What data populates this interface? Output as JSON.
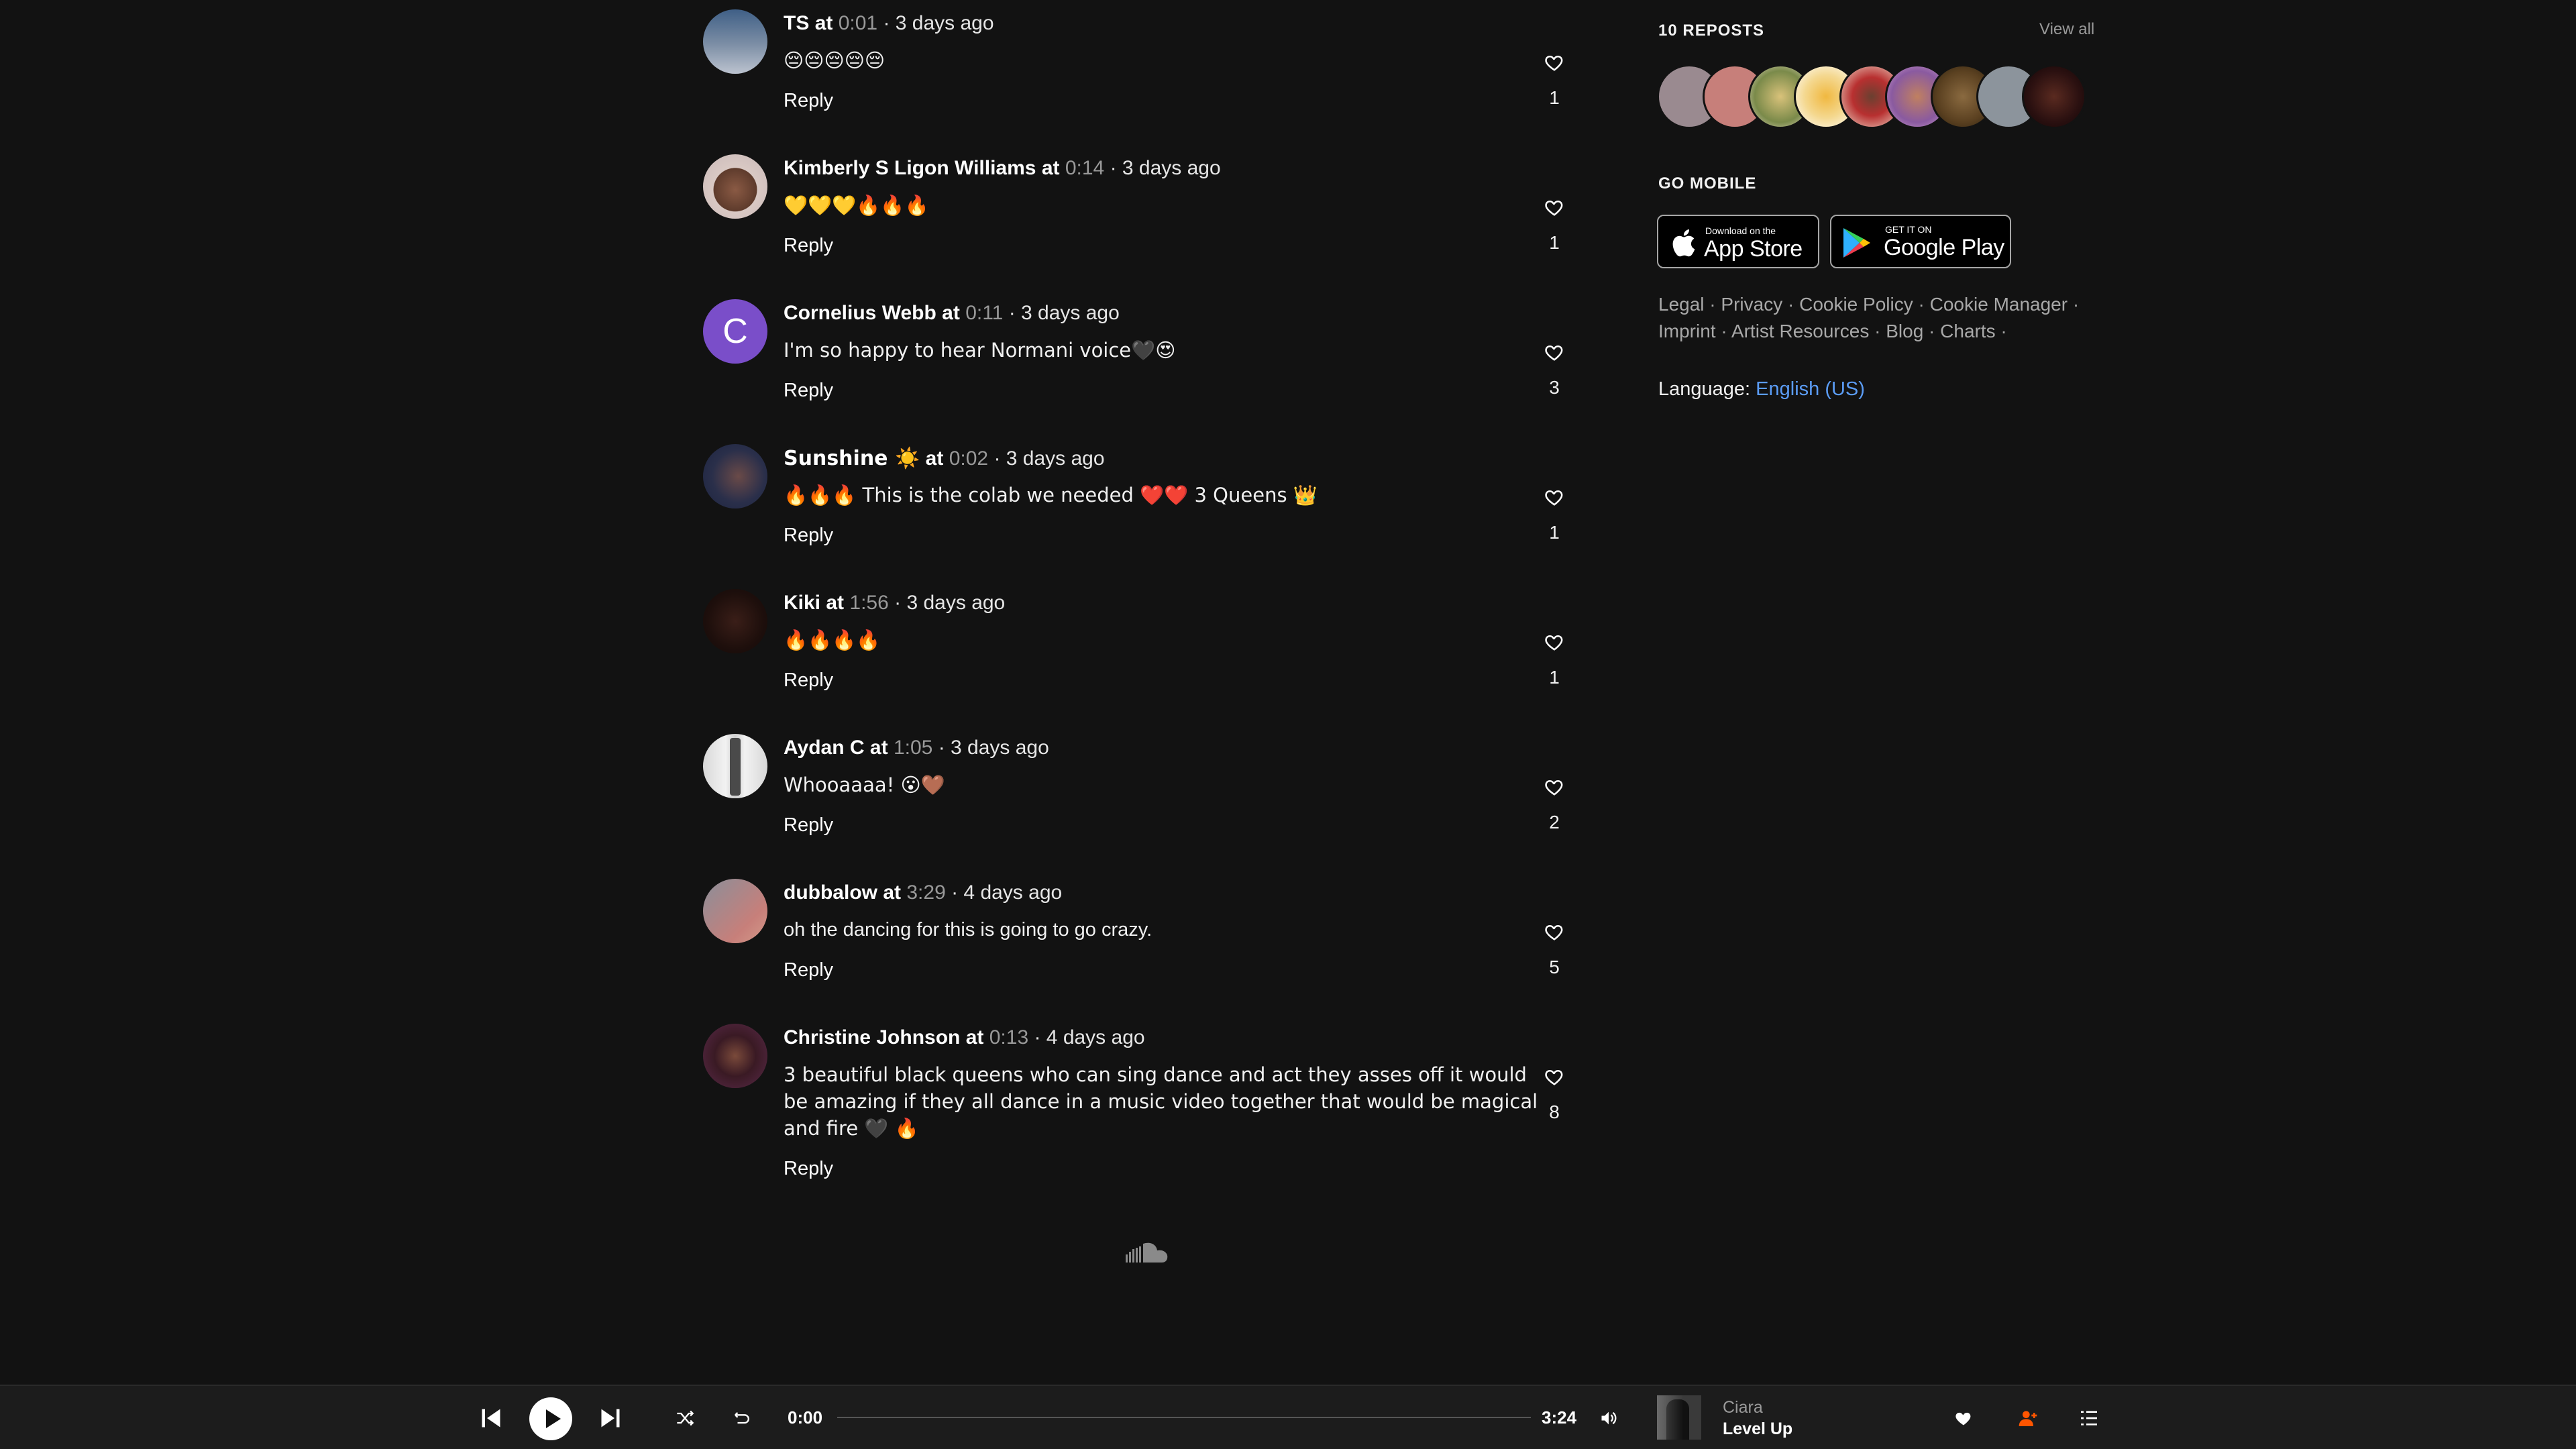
{
  "comments": [
    {
      "user": "TS",
      "time": "0:01",
      "ago": "· 3 days ago",
      "text": "😔😔😔😔😔",
      "reply": "Reply",
      "likes": "1"
    },
    {
      "user": "Kimberly S Ligon Williams",
      "time": "0:14",
      "ago": "· 3 days ago",
      "text": "💛💛💛🔥🔥🔥",
      "reply": "Reply",
      "likes": "1"
    },
    {
      "user": "Cornelius Webb",
      "time": "0:11",
      "ago": "· 3 days ago",
      "text": "I'm so happy to hear Normani voice🖤😍",
      "reply": "Reply",
      "likes": "3",
      "avatar_letter": "C"
    },
    {
      "user": "Sunshine ☀️",
      "time": "0:02",
      "ago": "· 3 days ago",
      "text": "🔥🔥🔥 This is the colab we needed ❤️❤️ 3 Queens 👑",
      "reply": "Reply",
      "likes": "1"
    },
    {
      "user": "Kiki",
      "time": "1:56",
      "ago": "· 3 days ago",
      "text": "🔥🔥🔥🔥",
      "reply": "Reply",
      "likes": "1"
    },
    {
      "user": "Aydan C",
      "time": "1:05",
      "ago": "· 3 days ago",
      "text": "Whooaaaa! 😮🤎",
      "reply": "Reply",
      "likes": "2"
    },
    {
      "user": "dubbalow",
      "time": "3:29",
      "ago": "· 4 days ago",
      "text": "oh the dancing for this is going to go crazy.",
      "reply": "Reply",
      "likes": "5"
    },
    {
      "user": "Christine Johnson",
      "time": "0:13",
      "ago": "· 4 days ago",
      "text": "3 beautiful black queens who can sing dance and act they asses off it would be amazing if they all dance in a music video together that would be magical and fire 🖤 🔥",
      "reply": "Reply",
      "likes": "8"
    }
  ],
  "at_word": "at",
  "sidebar": {
    "reposts_heading": "10 REPOSTS",
    "view_all": "View all",
    "go_mobile": "GO MOBILE",
    "app_store_small": "Download on the",
    "app_store_big": "App Store",
    "google_play_small": "GET IT ON",
    "google_play_big": "Google Play",
    "footer_links": [
      "Legal",
      "Privacy",
      "Cookie Policy",
      "Cookie Manager",
      "Imprint",
      "Artist Resources",
      "Blog",
      "Charts"
    ],
    "language_label": "Language:",
    "language_value": "English (US)"
  },
  "player": {
    "current_time": "0:00",
    "duration": "3:24",
    "progress": 0,
    "artist": "Ciara",
    "title": "Level Up"
  },
  "colors": {
    "background": "#121212",
    "accent": "#ff5500",
    "link": "#5b9cf5"
  }
}
